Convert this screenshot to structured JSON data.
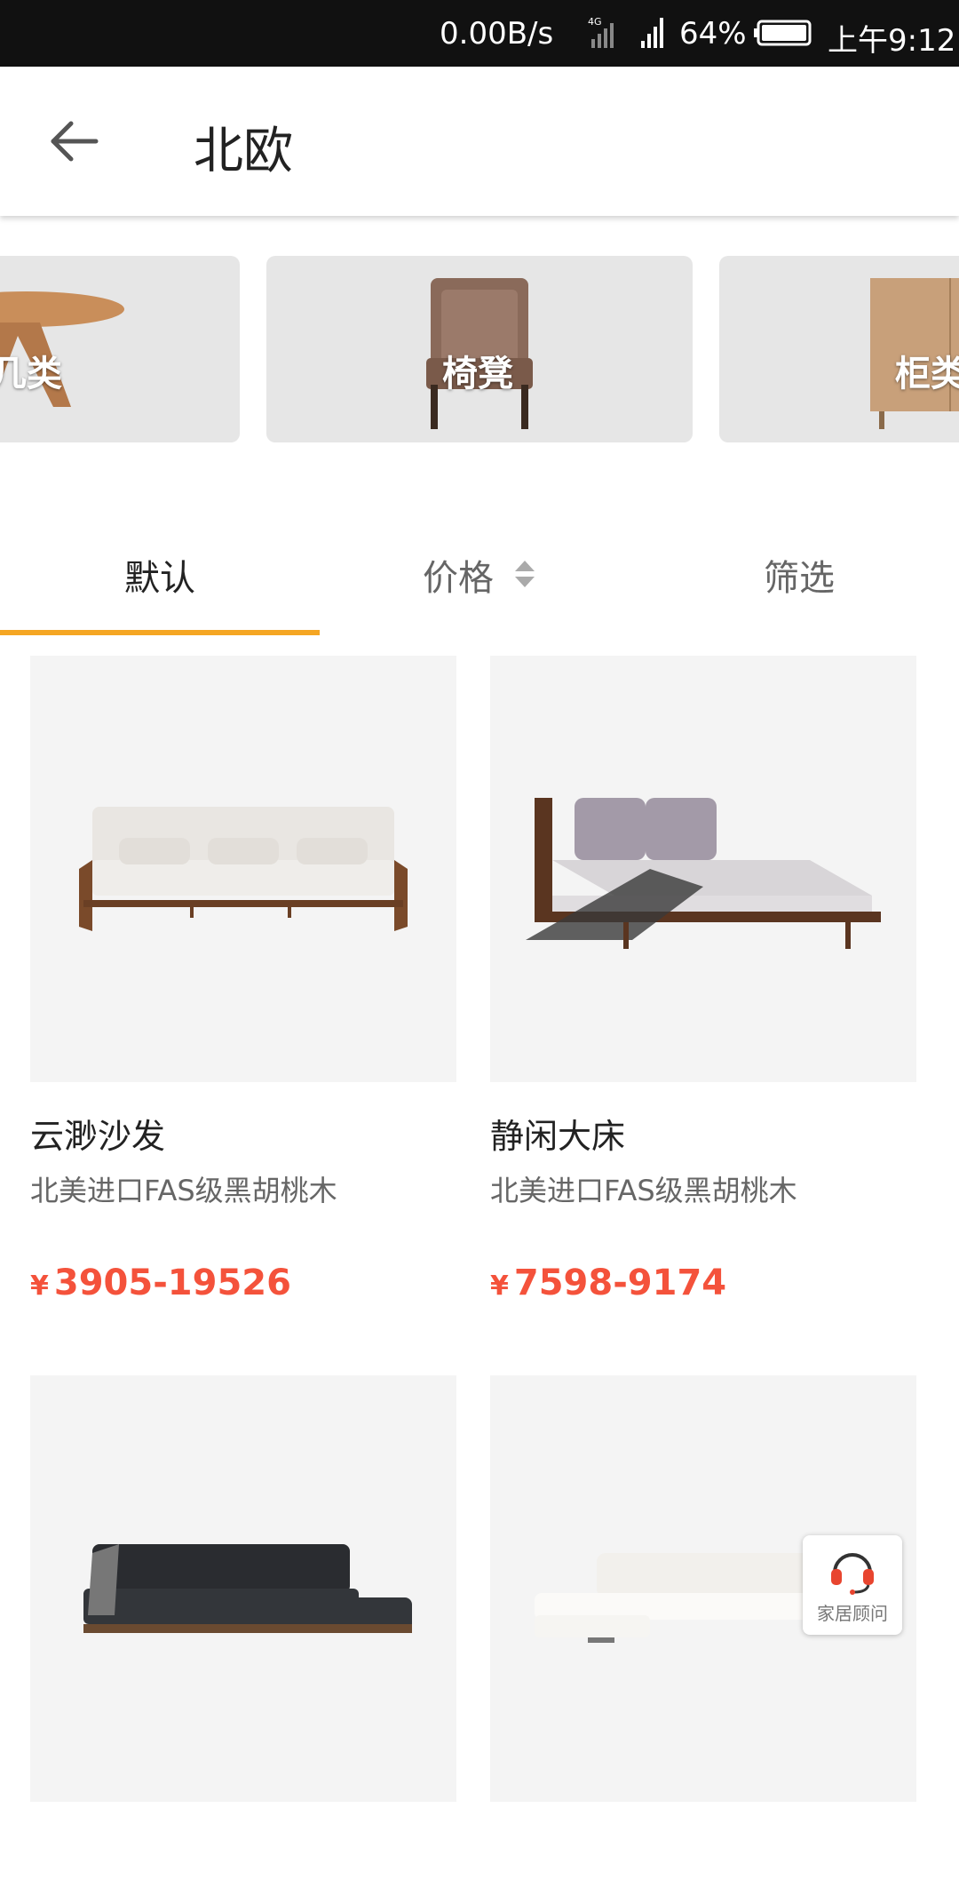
{
  "status": {
    "net_speed": "0.00B/s",
    "battery": "64%",
    "time": "上午9:12"
  },
  "header": {
    "title": "北欧"
  },
  "categories": [
    {
      "label": "几类"
    },
    {
      "label": "椅凳"
    },
    {
      "label": "柜类"
    }
  ],
  "sort_tabs": {
    "default": "默认",
    "price": "价格",
    "filter": "筛选"
  },
  "products": [
    {
      "name": "云渺沙发",
      "desc": "北美进口FAS级黑胡桃木",
      "currency": "¥",
      "price": "3905-19526"
    },
    {
      "name": "静闲大床",
      "desc": "北美进口FAS级黑胡桃木",
      "currency": "¥",
      "price": "7598-9174"
    },
    {
      "name": "",
      "desc": "",
      "currency": "",
      "price": ""
    },
    {
      "name": "",
      "desc": "",
      "currency": "",
      "price": ""
    }
  ],
  "advisor": {
    "label": "家居顾问"
  },
  "colors": {
    "accent": "#f5a623",
    "price": "#f4523b"
  }
}
